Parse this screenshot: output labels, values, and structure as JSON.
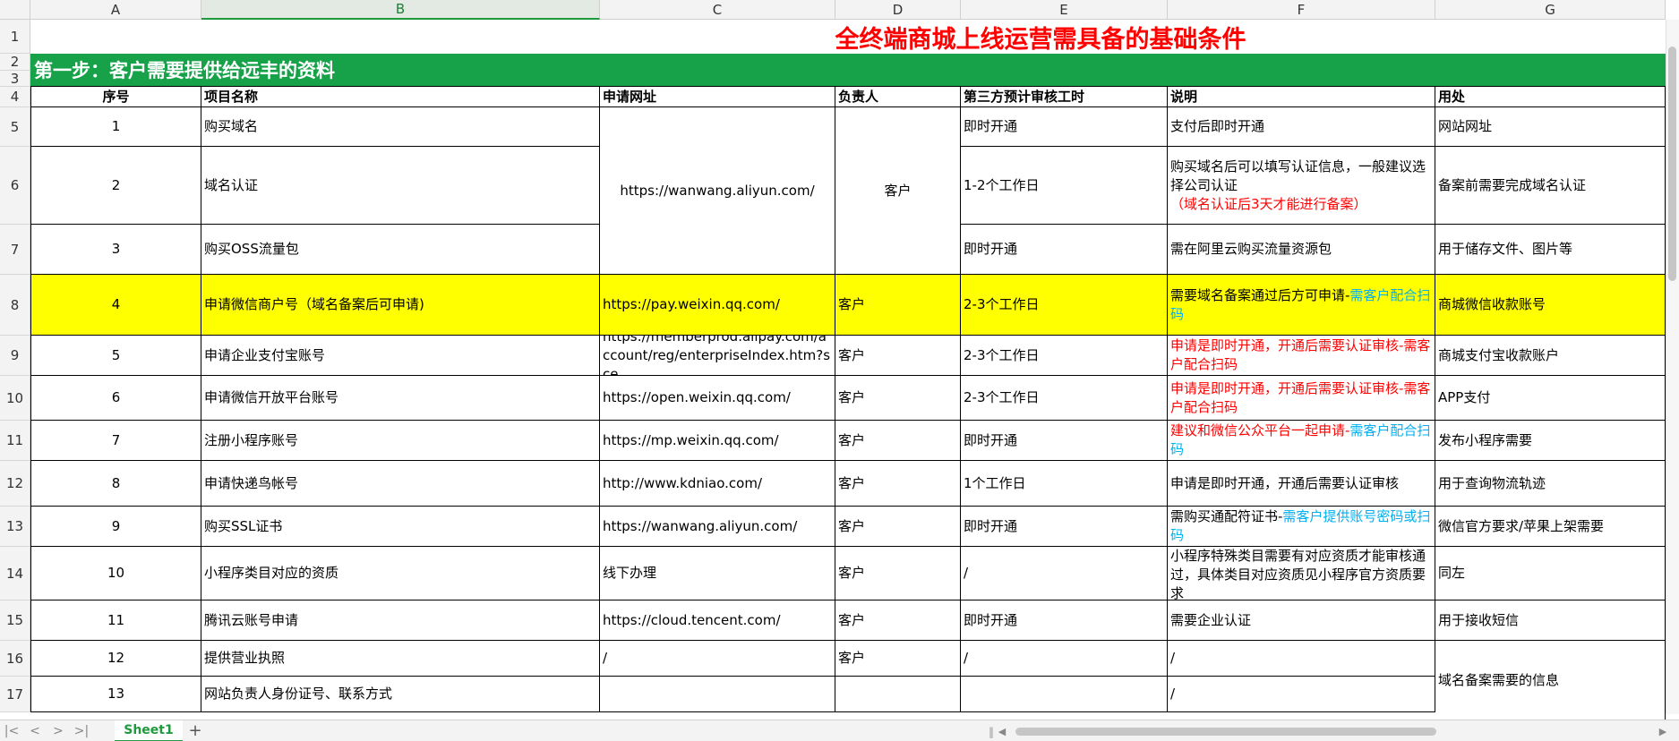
{
  "columns": [
    "A",
    "B",
    "C",
    "D",
    "E",
    "F",
    "G"
  ],
  "rows": [
    "1",
    "2",
    "3",
    "4",
    "5",
    "6",
    "7",
    "8",
    "9",
    "10",
    "11",
    "12",
    "13",
    "14",
    "15",
    "16",
    "17"
  ],
  "title": "全终端商城上线运营需具备的基础条件",
  "step": "第一步：客户需要提供给远丰的资料",
  "headers": {
    "seq": "序号",
    "name": "项目名称",
    "url": "申请网址",
    "owner": "负责人",
    "time": "第三方预计审核工时",
    "desc": "说明",
    "usage": "用处"
  },
  "merged": {
    "aliyun_url": "https://wanwang.aliyun.com/",
    "aliyun_owner": "客户",
    "beian_usage": "域名备案需要的信息"
  },
  "items": [
    {
      "seq": "1",
      "name": "购买域名",
      "time": "即时开通",
      "desc": "支付后即时开通",
      "usage": "网站网址"
    },
    {
      "seq": "2",
      "name": "域名认证",
      "time": "1-2个工作日",
      "desc": "购买域名后可以填写认证信息，一般建议选择公司认证",
      "desc_red": "（域名认证后3天才能进行备案）",
      "usage": "备案前需要完成域名认证"
    },
    {
      "seq": "3",
      "name": "购买OSS流量包",
      "time": "即时开通",
      "desc": "需在阿里云购买流量资源包",
      "usage": "用于储存文件、图片等"
    },
    {
      "seq": "4",
      "name": "申请微信商户号（域名备案后可申请)",
      "url": "https://pay.weixin.qq.com/",
      "owner": "客户",
      "time": "2-3个工作日",
      "desc": "需要域名备案通过后方可申请-",
      "desc_cyan": "需客户配合扫码",
      "usage": "商城微信收款账号"
    },
    {
      "seq": "5",
      "name": "申请企业支付宝账号",
      "url": "https://memberprod.alipay.com/account/reg/enterpriseIndex.htm?sce",
      "owner": "客户",
      "time": "2-3个工作日",
      "desc_red": "申请是即时开通，开通后需要认证审核-需客户配合扫码",
      "usage": "商城支付宝收款账户"
    },
    {
      "seq": "6",
      "name": "申请微信开放平台账号",
      "url": "https://open.weixin.qq.com/",
      "owner": "客户",
      "time": "2-3个工作日",
      "desc_red": "申请是即时开通，开通后需要认证审核-需客户配合扫码",
      "usage": "APP支付"
    },
    {
      "seq": "7",
      "name": "注册小程序账号",
      "url": "https://mp.weixin.qq.com/",
      "owner": "客户",
      "time": "即时开通",
      "desc_red": "建议和微信公众平台一起申请-",
      "desc_cyan": "需客户配合扫码",
      "usage": "发布小程序需要"
    },
    {
      "seq": "8",
      "name": "申请快递鸟帐号",
      "url": "http://www.kdniao.com/",
      "owner": "客户",
      "time": "1个工作日",
      "desc": "申请是即时开通，开通后需要认证审核",
      "usage": "用于查询物流轨迹"
    },
    {
      "seq": "9",
      "name": "购买SSL证书",
      "url": "https://wanwang.aliyun.com/",
      "owner": "客户",
      "time": "即时开通",
      "desc": "需购买通配符证书-",
      "desc_cyan": "需客户提供账号密码或扫码",
      "usage": "微信官方要求/苹果上架需要"
    },
    {
      "seq": "10",
      "name": "小程序类目对应的资质",
      "url": "线下办理",
      "owner": "客户",
      "time": "/",
      "desc": "小程序特殊类目需要有对应资质才能审核通过，具体类目对应资质见小程序官方资质要求",
      "usage": "同左"
    },
    {
      "seq": "11",
      "name": "腾讯云账号申请",
      "url": "https://cloud.tencent.com/",
      "owner": "客户",
      "time": "即时开通",
      "desc": "需要企业认证",
      "usage": "用于接收短信"
    },
    {
      "seq": "12",
      "name": "提供营业执照",
      "url": "/",
      "owner": "客户",
      "time": "/",
      "desc": "/"
    },
    {
      "seq": "13",
      "name": "网站负责人身份证号、联系方式",
      "url": "",
      "owner": "",
      "time": "",
      "desc": "/"
    }
  ],
  "tabs": {
    "sheet1": "Sheet1",
    "add": "+"
  },
  "nav": {
    "first": "|<",
    "prev": "<",
    "next": ">",
    "last": ">|"
  }
}
